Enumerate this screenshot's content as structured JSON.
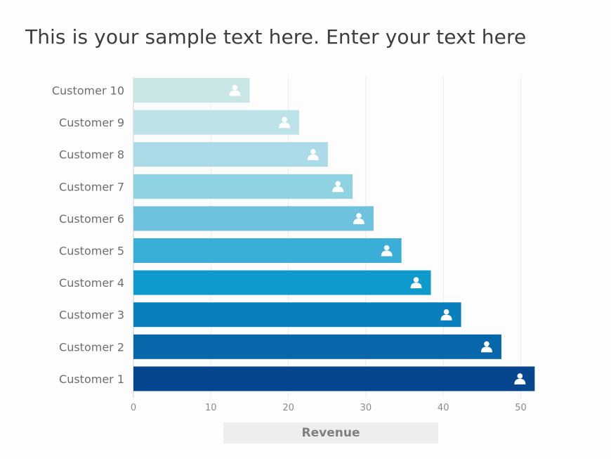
{
  "slide": {
    "title": "This is your sample text here. Enter your text here"
  },
  "chart_data": {
    "type": "bar",
    "orientation": "horizontal",
    "title": "This is your sample text here. Enter your text here",
    "xlabel": "Revenue",
    "ylabel": "",
    "categories": [
      "Customer 10",
      "Customer 9",
      "Customer 8",
      "Customer 7",
      "Customer 6",
      "Customer 5",
      "Customer 4",
      "Customer 3",
      "Customer 2",
      "Customer 1"
    ],
    "values": [
      15.0,
      21.4,
      25.1,
      28.3,
      31.0,
      34.6,
      38.4,
      42.3,
      47.5,
      51.8
    ],
    "colors": [
      "#c9e6e7",
      "#bde3e8",
      "#aadbe6",
      "#8fd3e2",
      "#6ec2de",
      "#3aaed6",
      "#0e9bcc",
      "#0a7fbd",
      "#0867ab",
      "#06468f"
    ],
    "bar_icon": "user-icon",
    "xlim": [
      0,
      52
    ],
    "xticks": [
      0,
      10,
      20,
      30,
      40,
      50
    ],
    "xtick_labels": [
      "0",
      "10",
      "20",
      "30",
      "40",
      "50"
    ],
    "grid": "vertical",
    "legend": "none"
  }
}
